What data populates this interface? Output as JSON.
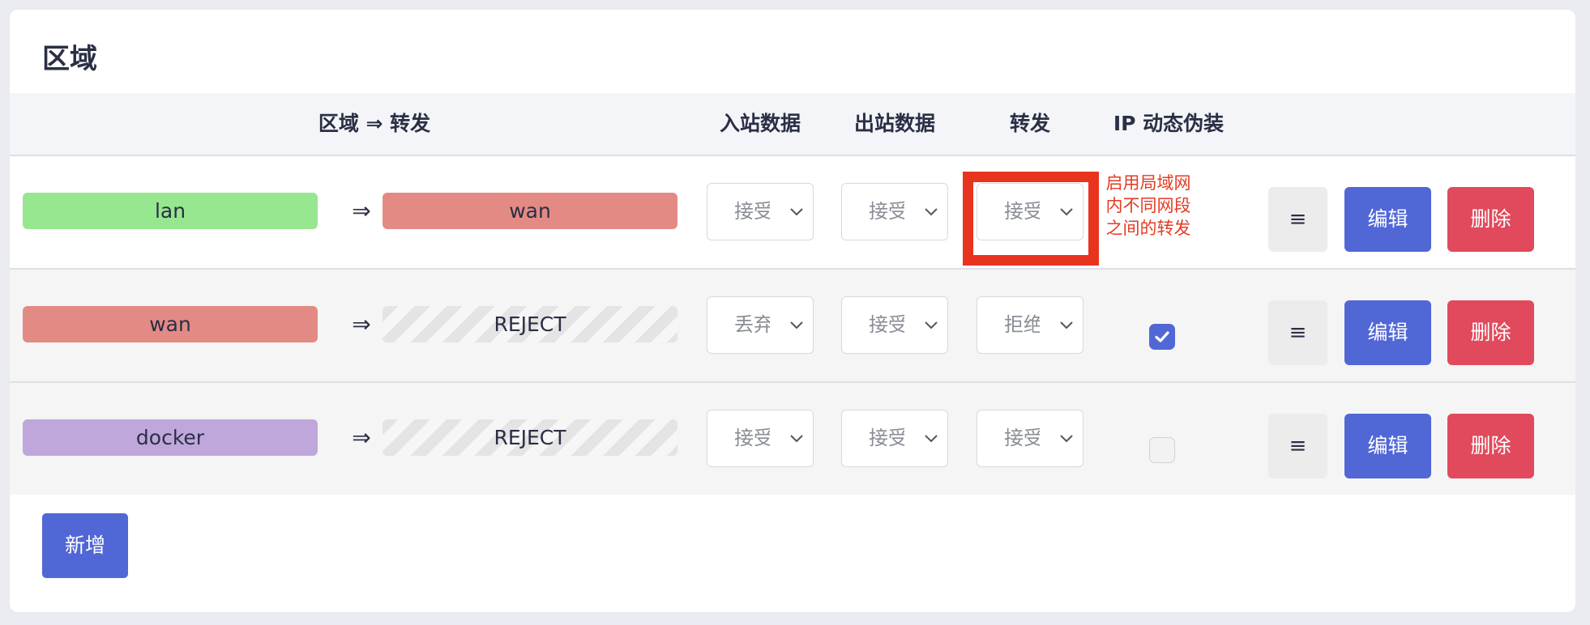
{
  "card": {
    "title": "区域"
  },
  "table": {
    "headers": {
      "zone_forward": "区域 ⇒ 转发",
      "input": "入站数据",
      "output": "出站数据",
      "forward": "转发",
      "masq": "IP 动态伪装"
    },
    "rows": [
      {
        "zone": "lan",
        "zone_color": "#96e78f",
        "arrow": "⇒",
        "target": "wan",
        "target_color": "#e38a85",
        "target_striped": false,
        "input": "接受",
        "output": "接受",
        "forward": "接受",
        "masq": null,
        "menu_label": "≡",
        "edit_label": "编辑",
        "delete_label": "删除"
      },
      {
        "zone": "wan",
        "zone_color": "#e38a85",
        "arrow": "⇒",
        "target": "REJECT",
        "target_striped": true,
        "input": "丢弃",
        "output": "接受",
        "forward": "拒绝",
        "masq": true,
        "menu_label": "≡",
        "edit_label": "编辑",
        "delete_label": "删除"
      },
      {
        "zone": "docker",
        "zone_color": "#bfa7dc",
        "arrow": "⇒",
        "target": "REJECT",
        "target_striped": true,
        "input": "接受",
        "output": "接受",
        "forward": "接受",
        "masq": false,
        "menu_label": "≡",
        "edit_label": "编辑",
        "delete_label": "删除"
      }
    ]
  },
  "annotation": {
    "note": "启用局域网内不同网段之间的转发",
    "color": "#e8331f"
  },
  "add_button": {
    "label": "新增"
  },
  "colors": {
    "accent": "#5167d6",
    "danger": "#e04a5c"
  },
  "icons": {
    "select": "chevron-down-icon",
    "checked": "checkmark-icon"
  }
}
